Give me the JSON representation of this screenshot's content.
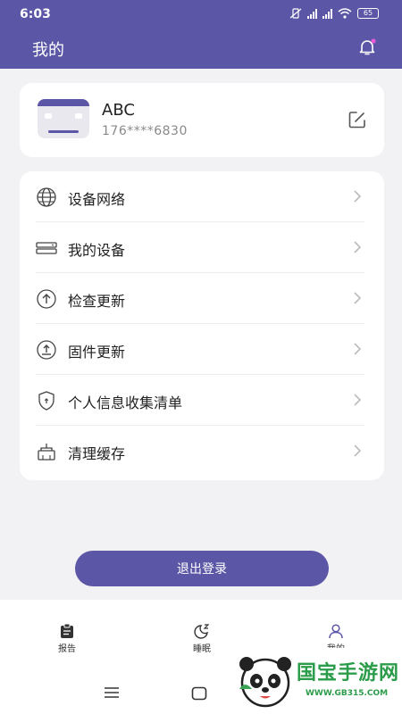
{
  "status_bar": {
    "time": "6:03",
    "battery": "65"
  },
  "header": {
    "title": "我的"
  },
  "profile": {
    "name": "ABC",
    "phone": "176****6830"
  },
  "menu": {
    "items": [
      {
        "label": "设备网络",
        "icon": "globe-icon"
      },
      {
        "label": "我的设备",
        "icon": "device-icon"
      },
      {
        "label": "检查更新",
        "icon": "upload-circle-icon"
      },
      {
        "label": "固件更新",
        "icon": "firmware-icon"
      },
      {
        "label": "个人信息收集清单",
        "icon": "shield-icon"
      },
      {
        "label": "清理缓存",
        "icon": "broom-icon"
      }
    ]
  },
  "actions": {
    "logout_label": "退出登录"
  },
  "tabbar": {
    "tabs": [
      {
        "label": "报告",
        "icon": "clipboard-icon"
      },
      {
        "label": "睡眠",
        "icon": "moon-icon"
      },
      {
        "label": "我的",
        "icon": "user-icon"
      }
    ]
  },
  "watermark": {
    "text": "国宝手游网",
    "url": "WWW.GB315.COM"
  },
  "colors": {
    "accent": "#5b57a6",
    "background": "#f2f2f4",
    "card": "#ffffff"
  }
}
